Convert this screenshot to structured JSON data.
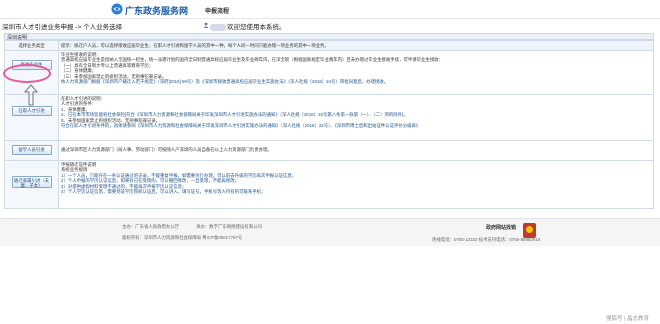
{
  "header": {
    "site_title": "广东政务服务网",
    "nav_link": "申报流程",
    "brand_color": "#1a5aa8"
  },
  "crumbs": {
    "path": "深圳市人才引进业务申报 -> 个人业务选择",
    "welcome": "欢迎您使用本系统。"
  },
  "section": {
    "title": "深圳说明"
  },
  "table": {
    "rows": [
      {
        "label": "选择业务类型",
        "content": "提示：拟迁户人员，可以选择接收应届毕业生，在职人才引进和留学人员的其中一种，每个人同一时间只能办理一项业务的其中一项业务。"
      },
      {
        "label": "接收毕业生",
        "content_lines": [
          "毕业生接收的说明：",
          "普通高校应届毕业生是指纳入全国统一招生，统一派遣计划的国内全日制普通高校应届毕业生及毕业两年内，在深全职（根据国家规定毕业两年内）且未办理过毕业生接收手续，可申请毕业生接收：",
          "（一）具有全日制大专以上普通高等教育学历；",
          "（二）身体健康；",
          "（三）未参加国家禁止的组织活动，无刑事犯罪记录。",
          "依人力资源部门根据《深圳市户籍迁入若干规定》（深府[2016] 59号）及《深圳市接收普通高校应届毕业生实施办法》（深人社规〔2016〕24号）审批同意后，办理接收。"
        ]
      },
      {
        "label": "在职人才引进",
        "content_lines": [
          "在职人才引进的说明：",
          "人才引进的条件：",
          "1、身体健康。",
          "2、已在本市市场监督机社会保险[符合《深圳市人力资源和社会保障局关于印发深圳市人才引进实施办法的通知》（深人社规〔2016〕22号第八条第一款第（一）、（二）项的除外]。",
          "3、未参加国家禁止的组织活动，无刑事犯罪记录。",
          "符合在职人才引进条件的，具体请参阅《深圳市人力资源和社会保障局关于印发深圳市人才引进实施办法的通知》（深人社规〔2016〕22号）、《深圳市博士后和出站证件认证评价分级表》"
        ]
      },
      {
        "label": "留学人员引进",
        "content": "通过深圳市区人力资源部门（局人事、劳动部门）可按随人户深圳的人员自备在以上人力资源部门负责办理。"
      },
      {
        "label": "随迁家属引进（夫妻、子女）",
        "content_lines": [
          "申报随迁证件说明",
          "系统业务规则",
          "1）一个人员，只能存在一条认证通过的记录，不能重复申报，如需要另行办理，可以前去升级的学历再次申报认证信息；",
          "2）个人申报的学历认证信息，如果有已在受理的，可以撤回修改，一旦受理，不能再修改；",
          "3）对提供虚假材料受理不通过的，不能再次申报学历认证信息；",
          "4）个人学历认证信息，需要到该学历院校认证后，可以进入，填写证号，手机号等人持有的可联系手机；"
        ]
      }
    ]
  },
  "footer": {
    "host": "主办：广东省人民政府办公厅",
    "co": "承办：数字广东网络建设有限公司",
    "org": "版权所有：深圳市人力资源和社会保障局  粤ICP备05017767号",
    "search_label": "政府网站找错",
    "hotline": "热线电话：0755-12333  技术支持电话：0755-88992919"
  },
  "annotation": {
    "highlight_color": "#e85a9a"
  },
  "watermark": "搜狐号 | 晶志教育"
}
